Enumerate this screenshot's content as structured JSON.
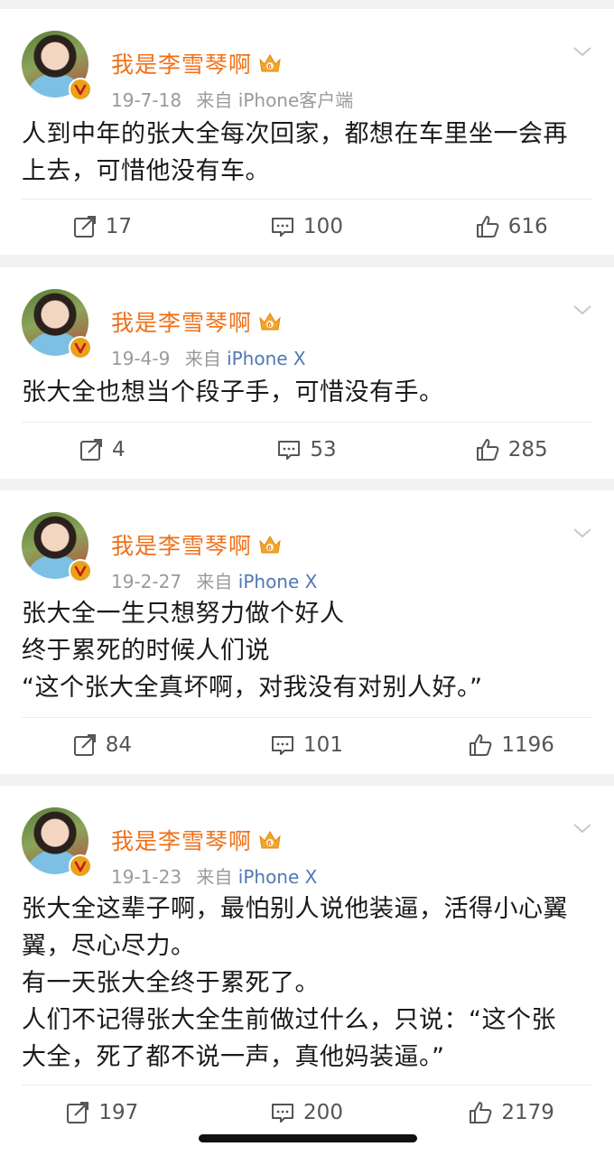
{
  "posts": [
    {
      "author": "我是李雪琴啊",
      "date": "19-7-18",
      "source_prefix": "来自",
      "source": "iPhone客户端",
      "lines": [
        "人到中年的张大全每次回家，都想在车里坐一会再",
        "上去，可惜他没有车。"
      ],
      "reposts": "17",
      "comments": "100",
      "likes": "616"
    },
    {
      "author": "我是李雪琴啊",
      "date": "19-4-9",
      "source_prefix": "来自",
      "source": "iPhone X",
      "lines": [
        "张大全也想当个段子手，可惜没有手。"
      ],
      "reposts": "4",
      "comments": "53",
      "likes": "285"
    },
    {
      "author": "我是李雪琴啊",
      "date": "19-2-27",
      "source_prefix": "来自",
      "source": "iPhone X",
      "lines": [
        "张大全一生只想努力做个好人",
        "终于累死的时候人们说",
        "“这个张大全真坏啊，对我没有对别人好。”"
      ],
      "reposts": "84",
      "comments": "101",
      "likes": "1196"
    },
    {
      "author": "我是李雪琴啊",
      "date": "19-1-23",
      "source_prefix": "来自",
      "source": "iPhone X",
      "lines": [
        "张大全这辈子啊，最怕别人说他装逼，活得小心翼",
        "翼，尽心尽力。",
        "有一天张大全终于累死了。",
        "人们不记得张大全生前做过什么，只说：“这个张",
        "大全，死了都不说一声，真他妈装逼。”"
      ],
      "reposts": "197",
      "comments": "200",
      "likes": "2179"
    }
  ],
  "colors": {
    "author": "#f07018",
    "meta": "#9a9a9a",
    "source_link": "#5078b4",
    "background": "#f2f2f2"
  }
}
